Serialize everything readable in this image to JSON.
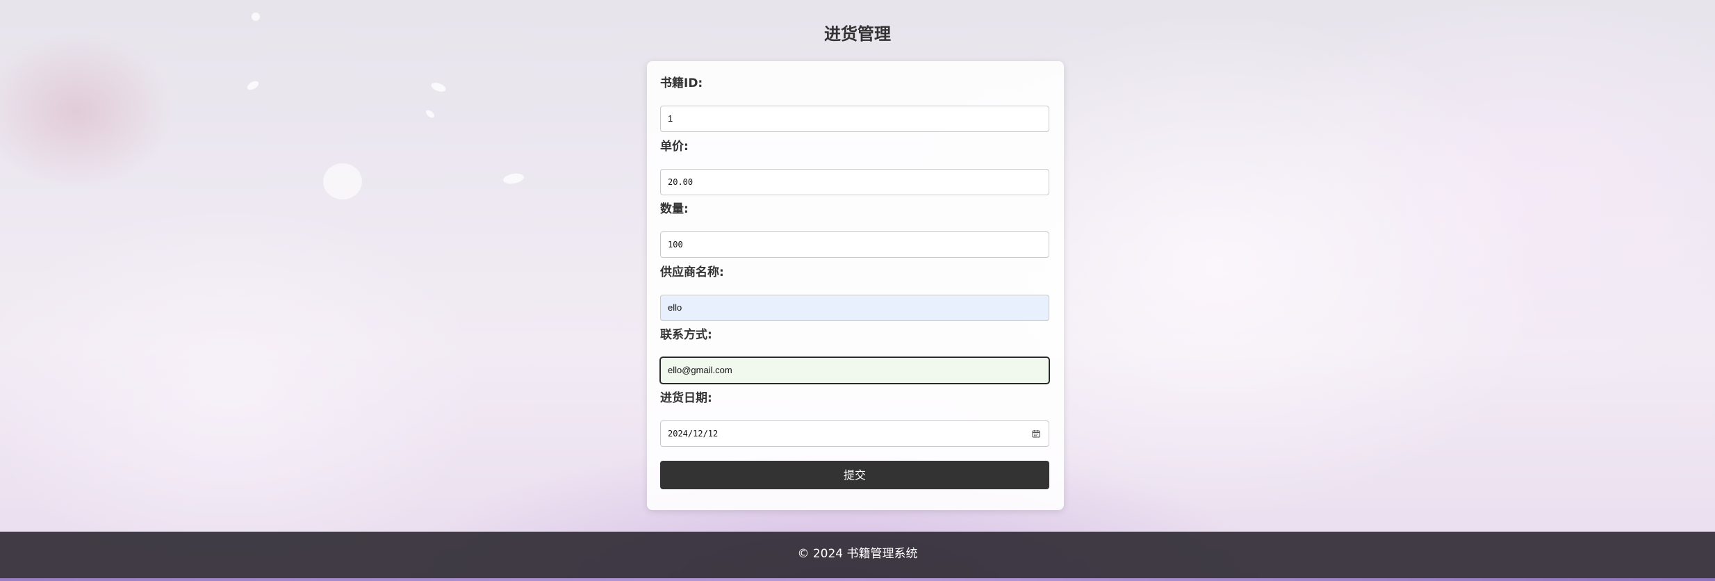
{
  "page": {
    "title": "进货管理"
  },
  "form": {
    "book_id": {
      "label": "书籍ID:",
      "value": "1"
    },
    "unit_price": {
      "label": "单价:",
      "value": "20.00"
    },
    "quantity": {
      "label": "数量:",
      "value": "100"
    },
    "supplier_name": {
      "label": "供应商名称:",
      "value": "ello"
    },
    "contact": {
      "label": "联系方式:",
      "value": "ello@gmail.com"
    },
    "purchase_date": {
      "label": "进货日期:",
      "value": "2024/12/12"
    },
    "submit_label": "提交"
  },
  "footer": {
    "text": "© 2024 书籍管理系统"
  },
  "colors": {
    "button_bg": "#333333",
    "footer_bg": "#28242c",
    "autofill_bg": "#e8f0fe",
    "focused_bg": "#f1f8ee"
  }
}
